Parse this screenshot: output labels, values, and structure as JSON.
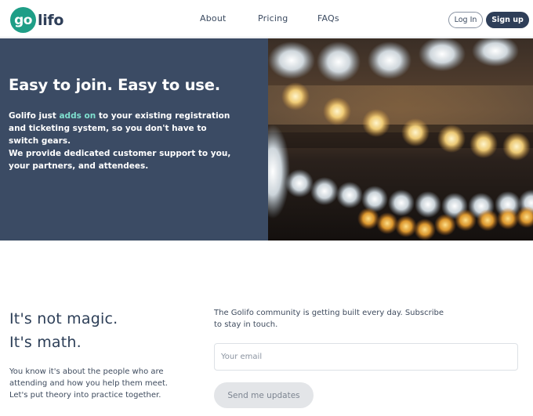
{
  "header": {
    "logo_badge": "go",
    "logo_rest": "lifo",
    "nav": [
      {
        "label": "About"
      },
      {
        "label": "Pricing"
      },
      {
        "label": "FAQs"
      }
    ],
    "login_label": "Log In",
    "signup_label": "Sign up"
  },
  "hero": {
    "title": "Easy to join. Easy to use.",
    "p1_before": "Golifo just ",
    "p1_highlight": "adds on",
    "p1_after": " to your existing registration and ticketing system, so you don't have to switch gears.",
    "p2": "We provide dedicated customer support to you, your partners, and attendees.",
    "background_color": "#3b4b64",
    "highlight_color": "#7fe0cf"
  },
  "section": {
    "heading_line1": "It's not magic.",
    "heading_line2": "It's math.",
    "body": "You know it's about the people who are attending and how you help them meet. Let's put theory into practice together.",
    "community_text": "The Golifo community is getting built every day. Subscribe to stay in touch.",
    "email_placeholder": "Your email",
    "submit_label": "Send me updates"
  },
  "colors": {
    "brand_teal": "#1f9e87",
    "brand_navy": "#2e3e58"
  }
}
